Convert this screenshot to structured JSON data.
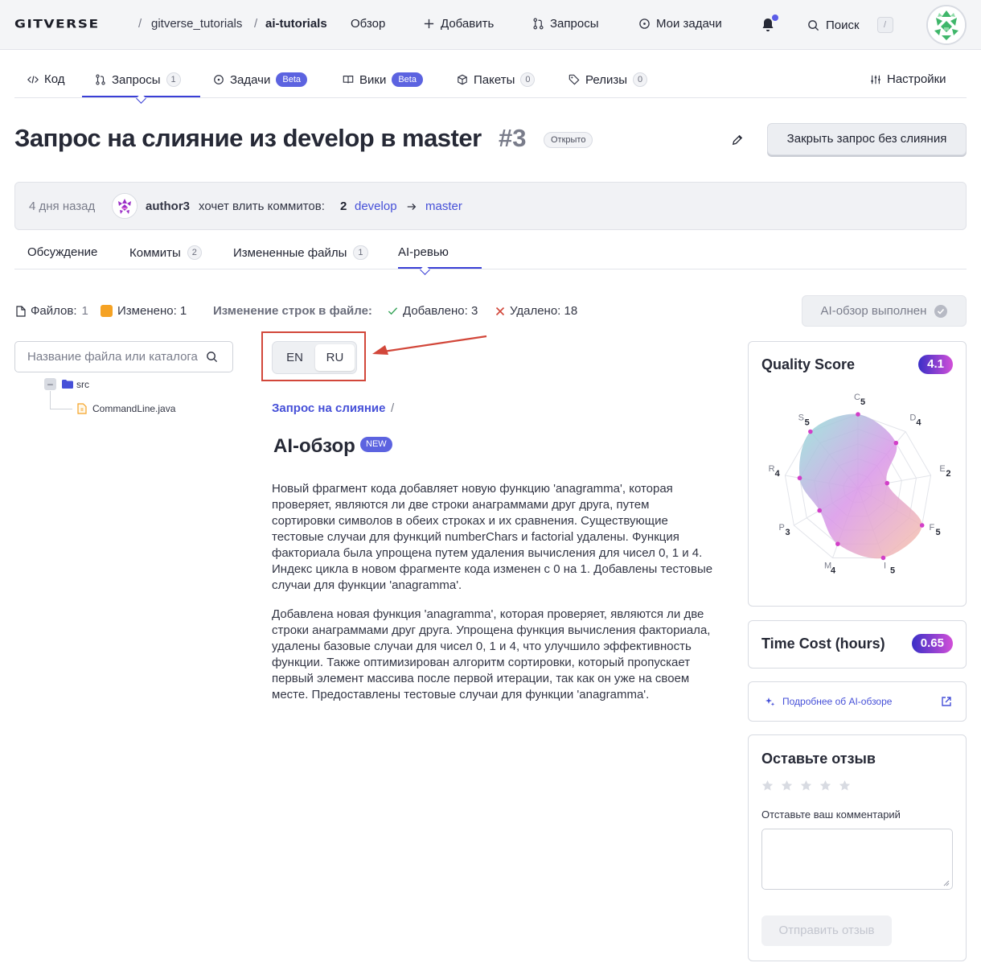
{
  "app": {
    "logo": "GITVERSE",
    "breadcrumb": {
      "owner": "gitverse_tutorials",
      "sep": "/",
      "repo": "ai-tutorials"
    }
  },
  "topnav": {
    "overview": "Обзор",
    "add": "Добавить",
    "requests": "Запросы",
    "tasks": "Мои задачи",
    "search": "Поиск",
    "search_kbd": "/"
  },
  "repo_tabs": [
    {
      "label": "Код"
    },
    {
      "label": "Запросы",
      "count": "1"
    },
    {
      "label": "Задачи",
      "badge": "Beta"
    },
    {
      "label": "Вики",
      "badge": "Beta"
    },
    {
      "label": "Пакеты",
      "count": "0"
    },
    {
      "label": "Релизы",
      "count": "0"
    },
    {
      "label": "Настройки"
    }
  ],
  "pr": {
    "title": "Запрос на слияние из develop в master",
    "number": "#3",
    "status": "Открыто",
    "close_button": "Закрыть запрос без слияния",
    "meta": {
      "time": "4 дня назад",
      "author": "author3",
      "text": "хочет влить коммитов:",
      "count": "2",
      "source": "develop",
      "target": "master"
    }
  },
  "pr_tabs": [
    {
      "label": "Обсуждение"
    },
    {
      "label": "Коммиты",
      "count": "2"
    },
    {
      "label": "Измененные файлы",
      "count": "1"
    },
    {
      "label": "AI-ревью"
    }
  ],
  "stats": {
    "files_label": "Файлов:",
    "files_value": "1",
    "changed_label": "Изменено: 1",
    "lines_label": "Изменение строк в файле:",
    "added": "Добавлено: 3",
    "removed": "Удалено: 18",
    "ai_done": "AI-обзор выполнен"
  },
  "tree": {
    "search_placeholder": "Название файла или каталога",
    "minus": "–",
    "folder": "src",
    "file": "CommandLine.java"
  },
  "lang": {
    "en": "EN",
    "ru": "RU",
    "active": "RU"
  },
  "review": {
    "breadcrumb": "Запрос на слияние",
    "breadcrumb_sep": "/",
    "title": "AI-обзор",
    "new_badge": "NEW",
    "paragraphs": [
      "Новый фрагмент кода добавляет новую функцию 'anagramma', которая проверяет, являются ли две строки анаграммами друг друга, путем сортировки символов в обеих строках и их сравнения. Существующие тестовые случаи для функций numberChars и factorial удалены. Функция факториала была упрощена путем удаления вычисления для чисел 0, 1 и 4. Индекс цикла в новом фрагменте кода изменен с 0 на 1. Добавлены тестовые случаи для функции 'anagramma'.",
      "Добавлена новая функция 'anagramma', которая проверяет, являются ли две строки анаграммами друг друга. Упрощена функция вычисления факториала, удалены базовые случаи для чисел 0, 1 и 4, что улучшило эффективность функции. Также оптимизирован алгоритм сортировки, который пропускает первый элемент массива после первой итерации, так как он уже на своем месте. Предоставлены тестовые случаи для функции 'anagramma'."
    ]
  },
  "quality": {
    "title": "Quality Score",
    "score": "4.1",
    "axes": [
      {
        "label": "C",
        "value": 5
      },
      {
        "label": "D",
        "value": 4
      },
      {
        "label": "E",
        "value": 2
      },
      {
        "label": "F",
        "value": 5
      },
      {
        "label": "I",
        "value": 5
      },
      {
        "label": "M",
        "value": 4
      },
      {
        "label": "P",
        "value": 3
      },
      {
        "label": "R",
        "value": 4
      },
      {
        "label": "S",
        "value": 5
      }
    ],
    "max": 5
  },
  "time_cost": {
    "title": "Time Cost (hours)",
    "value": "0.65"
  },
  "more_link": "Подробнее об AI-обзоре",
  "feedback": {
    "title": "Оставьте отзыв",
    "label": "Отставьте ваш комментарий",
    "submit": "Отправить отзыв"
  },
  "colors": {
    "accent": "#4650d8",
    "annotation": "#d2473a",
    "warning": "#f5a224",
    "success": "#3aa55c",
    "danger": "#d2473a"
  }
}
